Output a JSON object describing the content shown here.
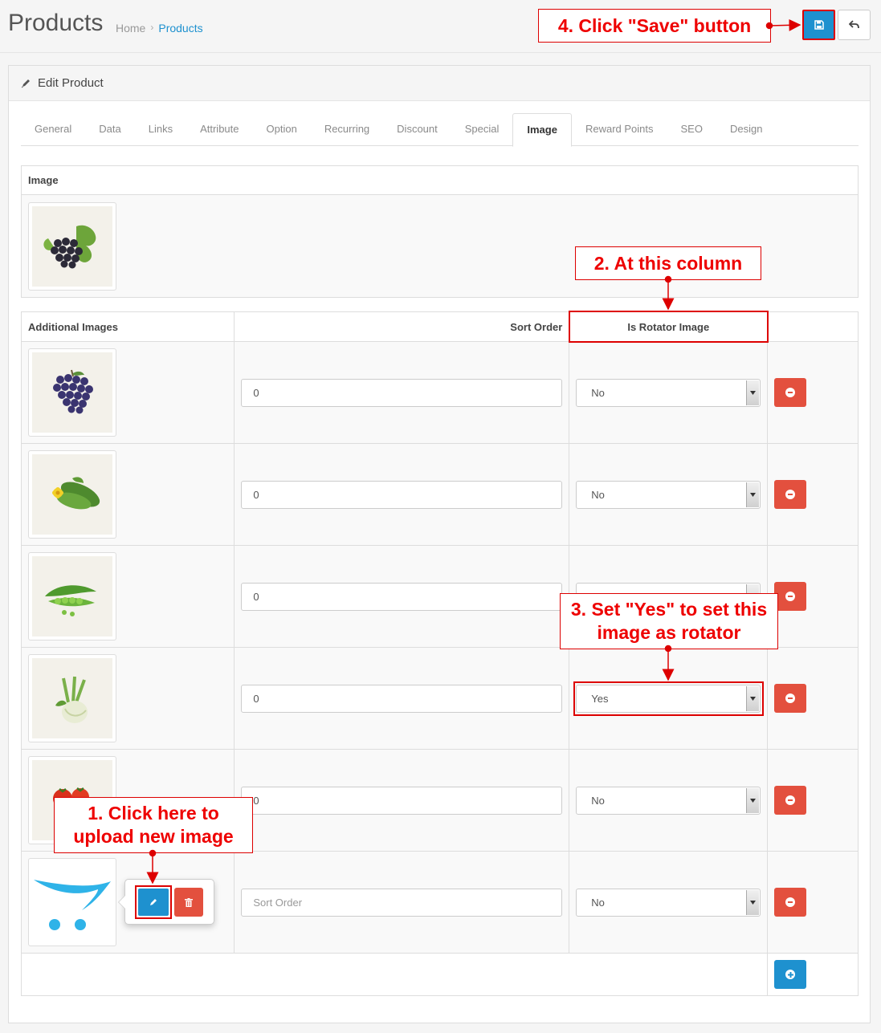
{
  "header": {
    "title": "Products",
    "breadcrumb": [
      "Home",
      "Products"
    ],
    "save_icon": "save-icon",
    "back_icon": "reply-icon"
  },
  "panel": {
    "heading": "Edit Product",
    "heading_icon": "pencil-icon"
  },
  "tabs": [
    "General",
    "Data",
    "Links",
    "Attribute",
    "Option",
    "Recurring",
    "Discount",
    "Special",
    "Image",
    "Reward Points",
    "SEO",
    "Design"
  ],
  "active_tab": "Image",
  "image_section": {
    "header": "Image",
    "image": "grapes with leaves"
  },
  "additional_images": {
    "headers": {
      "image": "Additional Images",
      "sort_order": "Sort Order",
      "rotator": "Is Rotator Image"
    },
    "rows": [
      {
        "image": "blue grapes",
        "sort_order": "0",
        "rotator": "No"
      },
      {
        "image": "cucumbers with flower",
        "sort_order": "0",
        "rotator": "No"
      },
      {
        "image": "green peas",
        "sort_order": "0",
        "rotator": ""
      },
      {
        "image": "fennel",
        "sort_order": "0",
        "rotator": "Yes"
      },
      {
        "image": "tomatoes",
        "sort_order": "0",
        "rotator": "No"
      },
      {
        "image": "opencart placeholder",
        "sort_order": "",
        "sort_order_placeholder": "Sort Order",
        "rotator": "No"
      }
    ]
  },
  "callouts": {
    "step1": "1. Click here to upload new image",
    "step2": "2. At this column",
    "step3": "3. Set \"Yes\" to set this image as rotator",
    "step4": "4. Click \"Save\" button"
  },
  "colors": {
    "primary": "#1e91cf",
    "danger": "#e3503e",
    "annotation": "#dd0000"
  }
}
